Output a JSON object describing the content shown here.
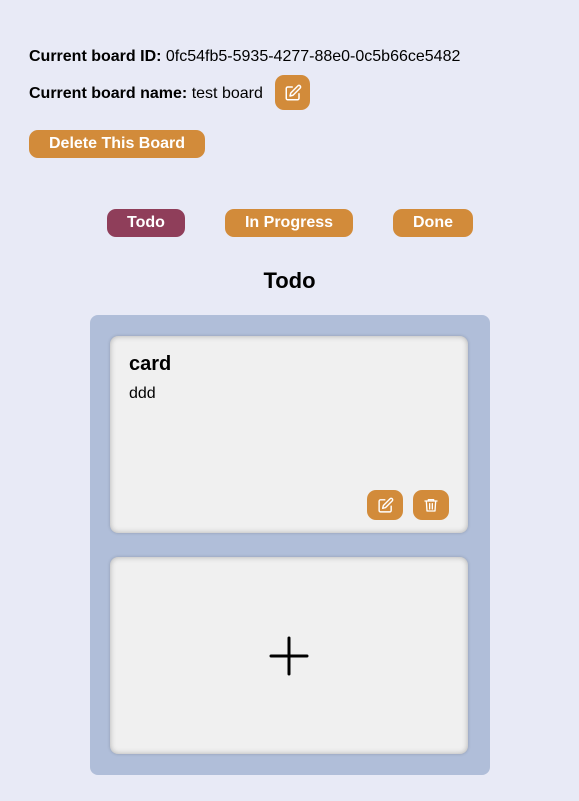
{
  "board": {
    "id_label": "Current board ID:",
    "id_value": "0fc54fb5-5935-4277-88e0-0c5b66ce5482",
    "name_label": "Current board name:",
    "name_value": "test board",
    "delete_label": "Delete This Board"
  },
  "tabs": [
    {
      "label": "Todo",
      "active": true
    },
    {
      "label": "In Progress",
      "active": false
    },
    {
      "label": "Done",
      "active": false
    }
  ],
  "column": {
    "title": "Todo",
    "cards": [
      {
        "title": "card",
        "description": "ddd"
      }
    ]
  },
  "colors": {
    "accent": "#d28b3a",
    "active_tab": "#8f3e5a",
    "background": "#e8eaf6",
    "column": "#b0bed9",
    "card": "#f0f0f0"
  },
  "icons": {
    "edit": "pencil-square-icon",
    "delete": "trash-icon",
    "add": "plus-icon"
  }
}
